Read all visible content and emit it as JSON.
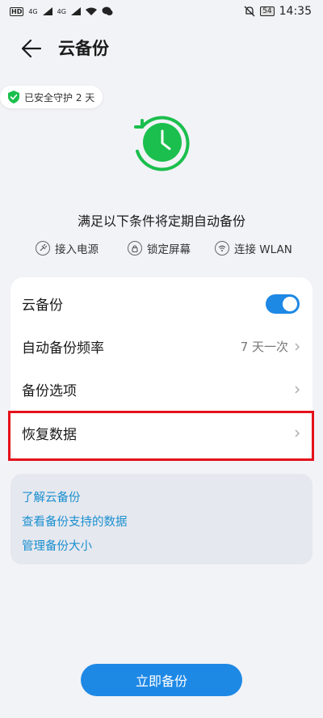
{
  "status_bar": {
    "badge1": "HD",
    "sig1": "4G",
    "sig2": "4G",
    "battery": "54",
    "time": "14:35"
  },
  "header": {
    "title": "云备份"
  },
  "protect_badge": {
    "text": "已安全守护 2 天"
  },
  "conditions": {
    "title": "满足以下条件将定期自动备份",
    "items": [
      {
        "label": "接入电源",
        "icon": "power-plug-icon"
      },
      {
        "label": "锁定屏幕",
        "icon": "lock-icon"
      },
      {
        "label": "连接 WLAN",
        "icon": "wifi-icon"
      }
    ]
  },
  "settings": {
    "cloud_backup": {
      "label": "云备份",
      "enabled": true
    },
    "frequency": {
      "label": "自动备份频率",
      "value": "7 天一次"
    },
    "options": {
      "label": "备份选项"
    },
    "restore": {
      "label": "恢复数据"
    }
  },
  "links": [
    {
      "label": "了解云备份"
    },
    {
      "label": "查看备份支持的数据"
    },
    {
      "label": "管理备份大小"
    }
  ],
  "actions": {
    "backup_now": "立即备份"
  },
  "colors": {
    "accent": "#1e88e5",
    "success": "#1bbf4d",
    "link": "#1a8fcf",
    "highlight": "#e5121b"
  }
}
